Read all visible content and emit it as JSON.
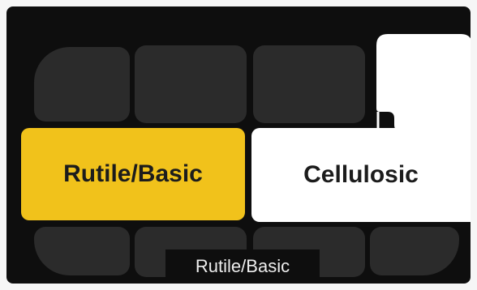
{
  "selector": {
    "options": [
      {
        "label": "Rutile/Basic",
        "state": "selected",
        "color": "#f1c21b"
      },
      {
        "label": "Cellulosic",
        "state": "unselected",
        "color": "#ffffff"
      }
    ],
    "inactive_color": "#2b2b2b",
    "background_color": "#0e0e0e"
  },
  "status": {
    "current_mode": "Rutile/Basic"
  }
}
